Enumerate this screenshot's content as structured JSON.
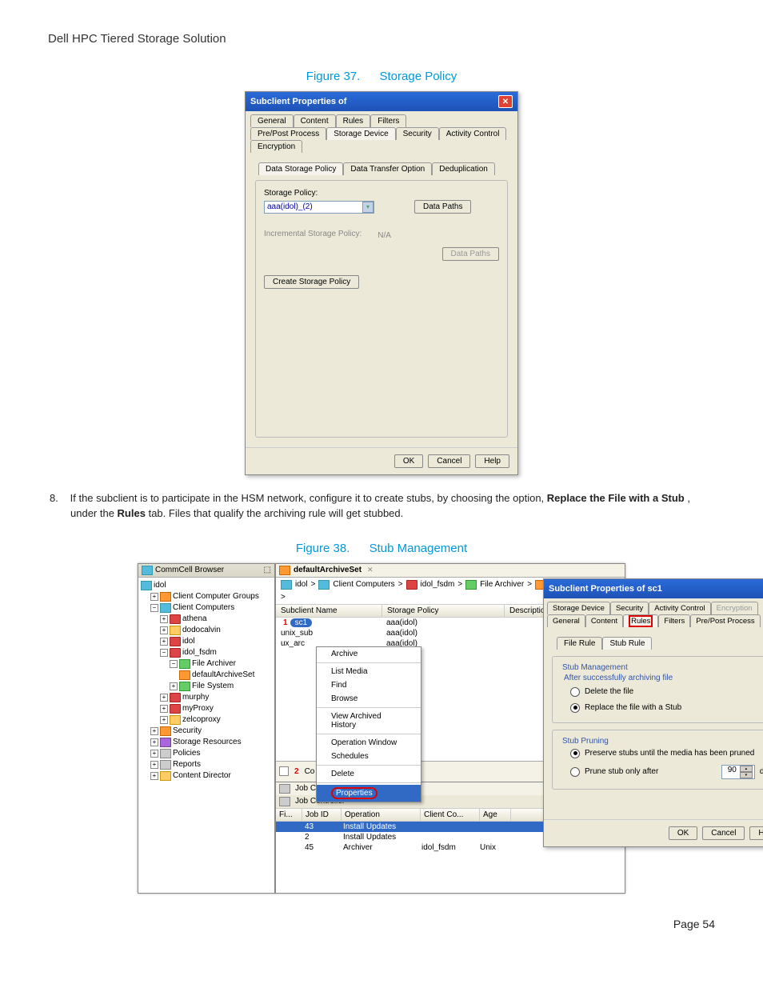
{
  "doc": {
    "header": "Dell HPC Tiered Storage Solution",
    "page": "Page 54"
  },
  "fig37": {
    "caption_num": "Figure 37.",
    "caption_title": "Storage Policy",
    "title": "Subclient Properties of",
    "tabs_row1": [
      "General",
      "Content",
      "Rules",
      "Filters"
    ],
    "tabs_row2": [
      "Pre/Post Process",
      "Storage Device",
      "Security",
      "Activity Control",
      "Encryption"
    ],
    "subtabs": [
      "Data Storage Policy",
      "Data Transfer Option",
      "Deduplication"
    ],
    "sp_label": "Storage Policy:",
    "sp_value": "aaa(idol)_(2)",
    "inc_label": "Incremental Storage Policy:",
    "inc_value": "N/A",
    "data_paths": "Data Paths",
    "create_btn": "Create Storage Policy",
    "ok": "OK",
    "cancel": "Cancel",
    "help": "Help"
  },
  "body": {
    "step_num": "8.",
    "text_a": "If the subclient is to participate in the HSM network, configure it to create stubs, by choosing the option, ",
    "bold_a": "Replace the File with a Stub",
    "text_b": ", under the ",
    "bold_b": "Rules",
    "text_c": " tab. Files that qualify the archiving rule will get stubbed."
  },
  "fig38": {
    "caption_num": "Figure 38.",
    "caption_title": "Stub Management",
    "browser_title": "CommCell Browser",
    "tree": {
      "root": "idol",
      "ccg": "Client Computer Groups",
      "cc": "Client Computers",
      "athena": "athena",
      "dodocalvin": "dodocalvin",
      "idol": "idol",
      "idol_fsdm": "idol_fsdm",
      "file_archiver": "File Archiver",
      "default_as": "defaultArchiveSet",
      "file_system": "File System",
      "murphy": "murphy",
      "myproxy": "myProxy",
      "zelcoproxy": "zelcoproxy",
      "security": "Security",
      "storage_res": "Storage Resources",
      "policies": "Policies",
      "reports": "Reports",
      "content_dir": "Content Director"
    },
    "tab_name": "defaultArchiveSet",
    "breadcrumb": [
      "idol",
      ">",
      "Client Computers",
      ">",
      "idol_fsdm",
      ">",
      "File Archiver",
      ">",
      "defaultArchiveSet",
      ">"
    ],
    "cols": [
      "Subclient Name",
      "Storage Policy",
      "Description"
    ],
    "rows": [
      {
        "name": "sc1",
        "sp": "aaa(idol)"
      },
      {
        "name": "unix_sub",
        "sp": "aaa(idol)"
      },
      {
        "name": "ux_arc",
        "sp": "aaa(idol)"
      }
    ],
    "menu": [
      "Archive",
      "List Media",
      "Find",
      "Browse",
      "View Archived History",
      "Operation Window",
      "Schedules",
      "Delete",
      "Properties"
    ],
    "job": {
      "tab": "Job Controller",
      "cols": [
        "Fi...",
        "Job ID",
        "Operation",
        "Client Co...",
        "Age"
      ],
      "r1": {
        "f": "",
        "id": "43",
        "op": "Install Updates",
        "cc": "",
        "age": ""
      },
      "r2": {
        "f": "",
        "id": "2",
        "op": "Install Updates",
        "cc": "",
        "age": ""
      },
      "r3": {
        "f": "",
        "id": "45",
        "op": "Archiver",
        "cc": "idol_fsdm",
        "age": "Unix"
      }
    },
    "calendar_label": "Co"
  },
  "dlg2": {
    "title": "Subclient Properties of sc1",
    "tabs_row1": [
      "Storage Device",
      "Security",
      "Activity Control",
      "Encryption"
    ],
    "tabs_row2": [
      "General",
      "Content",
      "Rules",
      "Filters",
      "Pre/Post Process"
    ],
    "subtabs": [
      "File Rule",
      "Stub Rule"
    ],
    "stub_mgmt": "Stub Management",
    "after": "After successfully archiving file",
    "opt1": "Delete the file",
    "opt2": "Replace the file with a Stub",
    "pruning": "Stub Pruning",
    "opt3": "Preserve stubs until the media has been pruned",
    "opt4": "Prune stub only after",
    "days_val": "90",
    "days": "days",
    "ok": "OK",
    "cancel": "Cancel",
    "help": "Help"
  }
}
